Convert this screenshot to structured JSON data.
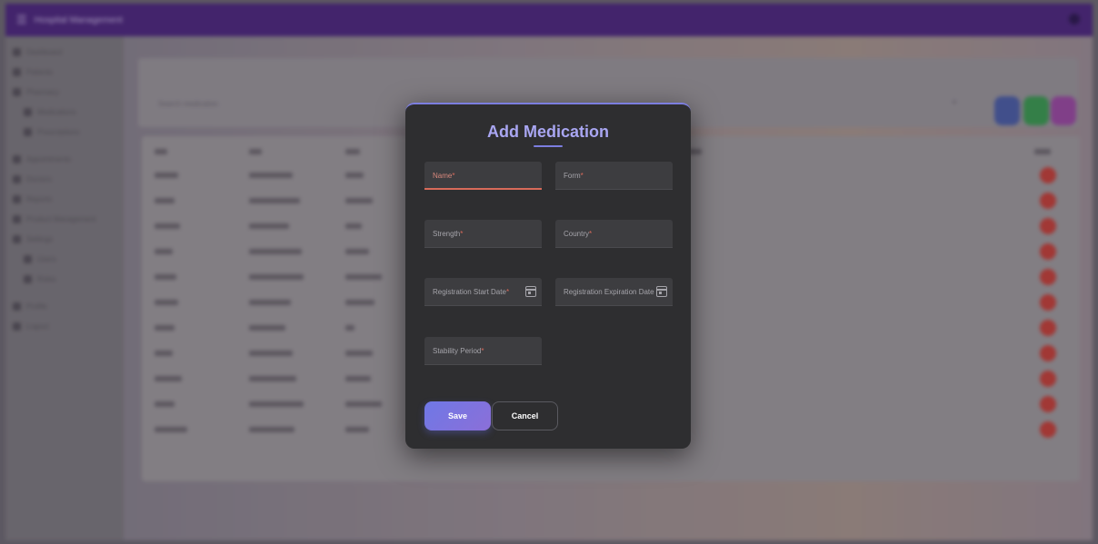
{
  "app": {
    "title": "Hospital Management",
    "menu_icon": "menu-icon",
    "user_icon": "account-icon"
  },
  "sidebar": {
    "items": [
      {
        "label": "Dashboard"
      },
      {
        "label": "Patients"
      },
      {
        "label": "Pharmacy"
      },
      {
        "label": "Medications",
        "sub": true
      },
      {
        "label": "Prescriptions",
        "sub": true
      },
      {
        "label": "Appointments"
      },
      {
        "label": "Doctors"
      },
      {
        "label": "Reports"
      },
      {
        "label": "Product Management"
      },
      {
        "label": "Settings"
      },
      {
        "label": "Users",
        "sub": true
      },
      {
        "label": "Roles",
        "sub": true
      },
      {
        "label": "Profile"
      },
      {
        "label": "Logout"
      }
    ]
  },
  "search": {
    "placeholder": "Search medication"
  },
  "table": {
    "action_header": "Action"
  },
  "dialog": {
    "title": "Add Medication",
    "fields": {
      "name": "Name",
      "form": "Form",
      "strength": "Strength",
      "country": "Country",
      "reg_start": "Registration Start Date",
      "reg_exp": "Registration Expiration Date",
      "stability": "Stability Period"
    },
    "required_mark": "*",
    "save_label": "Save",
    "cancel_label": "Cancel"
  },
  "colors": {
    "topbar": "#4d2780",
    "accent": "#7c7ee0",
    "title": "#a9a6f2",
    "error": "#d86a5a",
    "delete": "#c6403a"
  }
}
